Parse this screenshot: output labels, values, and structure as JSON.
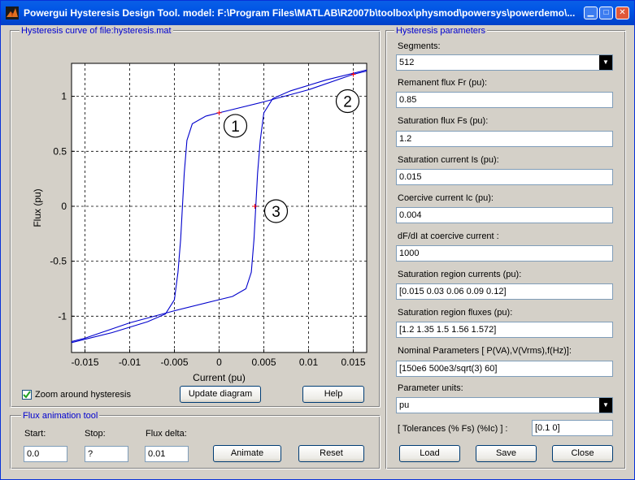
{
  "window": {
    "title": "Powergui Hysteresis Design Tool. model: F:\\Program Files\\MATLAB\\R2007b\\toolbox\\physmod\\powersys\\powerdemo\\..."
  },
  "curve_panel": {
    "title": "Hysteresis curve of file:hysteresis.mat",
    "zoom_label": "Zoom around hysteresis",
    "zoom_checked": true,
    "update_button": "Update diagram",
    "help_button": "Help"
  },
  "chart_data": {
    "type": "line",
    "xlabel": "Current (pu)",
    "ylabel": "Flux (pu)",
    "xlim": [
      -0.0165,
      0.0165
    ],
    "ylim": [
      -1.33,
      1.3
    ],
    "xticks": [
      "-0.015",
      "-0.01",
      "-0.005",
      "0",
      "0.005",
      "0.01",
      "0.015"
    ],
    "xtick_values": [
      -0.015,
      -0.01,
      -0.005,
      0,
      0.005,
      0.01,
      0.015
    ],
    "yticks": [
      "1",
      "0.5",
      "0",
      "-0.5",
      "-1"
    ],
    "ytick_values": [
      1,
      0.5,
      0,
      -0.5,
      -1
    ],
    "grid": true,
    "line_color": "#0000cc",
    "marker_color": "#ff0000",
    "series": [
      {
        "x": [
          -0.0165,
          -0.012,
          -0.008,
          -0.006,
          -0.005,
          -0.0046,
          -0.0043,
          -0.0041,
          -0.0039,
          -0.0036,
          -0.003,
          -0.0015,
          0,
          0.005,
          0.01,
          0.015,
          0.0165
        ],
        "y": [
          -1.24,
          -1.15,
          -1.05,
          -0.98,
          -0.85,
          -0.6,
          -0.3,
          0,
          0.3,
          0.6,
          0.75,
          0.82,
          0.85,
          0.95,
          1.06,
          1.2,
          1.23
        ]
      },
      {
        "x": [
          -0.0165,
          -0.015,
          -0.01,
          -0.005,
          0,
          0.0015,
          0.003,
          0.0036,
          0.0039,
          0.0041,
          0.0043,
          0.0046,
          0.005,
          0.006,
          0.008,
          0.012,
          0.0165
        ],
        "y": [
          -1.23,
          -1.2,
          -1.06,
          -0.95,
          -0.85,
          -0.82,
          -0.75,
          -0.6,
          -0.3,
          0,
          0.3,
          0.6,
          0.85,
          0.98,
          1.05,
          1.15,
          1.24
        ]
      }
    ],
    "markers": [
      {
        "x": 0,
        "y": 0.85,
        "label": "1"
      },
      {
        "x": 0.015,
        "y": 1.2,
        "label": "2"
      },
      {
        "x": 0.004,
        "y": 0,
        "label": "3"
      }
    ]
  },
  "flux_panel": {
    "title": "Flux animation tool",
    "start_label": "Start:",
    "start_value": "0.0",
    "stop_label": "Stop:",
    "stop_value": "?",
    "delta_label": "Flux delta:",
    "delta_value": "0.01",
    "animate_button": "Animate",
    "reset_button": "Reset"
  },
  "params": {
    "title": "Hysteresis parameters",
    "segments_label": "Segments:",
    "segments_value": "512",
    "fr_label": "Remanent flux Fr (pu):",
    "fr_value": "0.85",
    "fs_label": "Saturation flux Fs (pu):",
    "fs_value": "1.2",
    "is_label": "Saturation current Is (pu):",
    "is_value": "0.015",
    "ic_label": "Coercive current Ic (pu):",
    "ic_value": "0.004",
    "dfdi_label": "dF/dI at coercive current :",
    "dfdi_value": "1000",
    "src_label": "Saturation region currents (pu):",
    "src_value": "[0.015 0.03 0.06 0.09 0.12]",
    "srf_label": "Saturation region fluxes (pu):",
    "srf_value": "[1.2 1.35 1.5 1.56 1.572]",
    "nominal_label": "Nominal Parameters [ P(VA),V(Vrms),f(Hz)]:",
    "nominal_value": "[150e6  500e3/sqrt(3)  60]",
    "units_label": "Parameter units:",
    "units_value": "pu",
    "tol_label": "[ Tolerances  (% Fs)  (%Ic) ] :",
    "tol_value": "[0.1 0]",
    "load_button": "Load",
    "save_button": "Save",
    "close_button": "Close"
  }
}
